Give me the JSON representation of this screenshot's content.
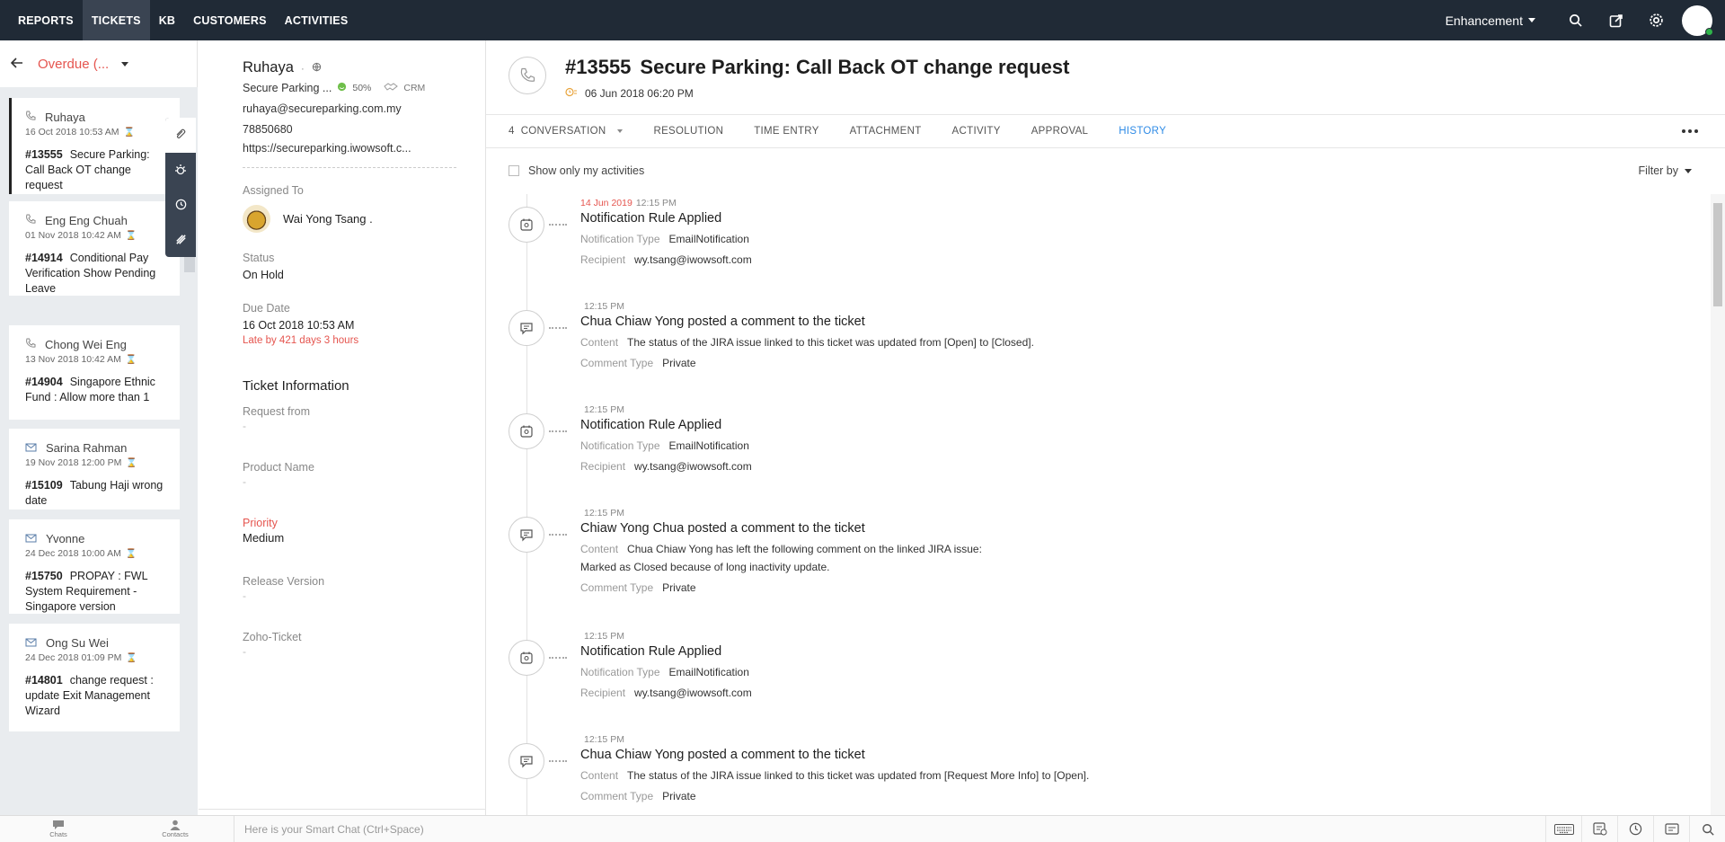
{
  "nav": {
    "items": [
      "REPORTS",
      "TICKETS",
      "KB",
      "CUSTOMERS",
      "ACTIVITIES"
    ],
    "active": "TICKETS",
    "department": "Enhancement"
  },
  "list": {
    "view_label": "Overdue (...",
    "cards": [
      {
        "contact": "Ruhaya",
        "time": "16 Oct 2018 10:53 AM",
        "number": "#13555",
        "subject": "Secure Parking: Call Back OT change request",
        "channel": "phone"
      },
      {
        "contact": "Eng Eng Chuah",
        "time": "01 Nov 2018 10:42 AM",
        "number": "#14914",
        "subject": "Conditional Pay Verification Show Pending Leave",
        "channel": "phone"
      },
      {
        "contact": "Chong Wei Eng",
        "time": "13 Nov 2018 10:42 AM",
        "number": "#14904",
        "subject": "Singapore Ethnic Fund : Allow more than 1",
        "channel": "phone"
      },
      {
        "contact": "Sarina Rahman",
        "time": "19 Nov 2018 12:00 PM",
        "number": "#15109",
        "subject": "Tabung Haji wrong date",
        "channel": "email"
      },
      {
        "contact": "Yvonne",
        "time": "24 Dec 2018 10:00 AM",
        "number": "#15750",
        "subject": "PROPAY : FWL System Requirement - Singapore version",
        "channel": "email"
      },
      {
        "contact": "Ong Su Wei",
        "time": "24 Dec 2018 01:09 PM",
        "number": "#14801",
        "subject": "change request : update Exit Management Wizard",
        "channel": "email"
      }
    ]
  },
  "contact": {
    "name": "Ruhaya",
    "account": "Secure Parking ...",
    "happiness": "50%",
    "crm": "CRM",
    "email": "ruhaya@secureparking.com.my",
    "phone": "78850680",
    "website": "https://secureparking.iwowsoft.c..."
  },
  "props": {
    "assigned_label": "Assigned To",
    "assigned_value": "Wai Yong Tsang .",
    "status_label": "Status",
    "status_value": "On Hold",
    "due_label": "Due Date",
    "due_value": "16 Oct 2018 10:53 AM",
    "late": "Late by 421 days 3 hours",
    "section": "Ticket Information",
    "request_label": "Request from",
    "request_value": "-",
    "product_label": "Product Name",
    "product_value": "-",
    "priority_label": "Priority",
    "priority_value": "Medium",
    "release_label": "Release Version",
    "release_value": "-",
    "zoho_label": "Zoho-Ticket",
    "zoho_value": "-"
  },
  "ticket": {
    "number": "#13555",
    "subject": "Secure Parking: Call Back OT change request",
    "created": "06 Jun 2018 06:20 PM"
  },
  "tabs": {
    "conversation_count": "4",
    "items": [
      "CONVERSATION",
      "RESOLUTION",
      "TIME ENTRY",
      "ATTACHMENT",
      "ACTIVITY",
      "APPROVAL",
      "HISTORY"
    ],
    "active": "HISTORY"
  },
  "history": {
    "show_mine": "Show only my activities",
    "filter": "Filter by",
    "entries": [
      {
        "date": "14 Jun 2019",
        "time": "12:15 PM",
        "title": "Notification Rule Applied",
        "icon": "rule-icon",
        "rows": [
          {
            "k": "Notification Type",
            "v": "EmailNotification"
          },
          {
            "k": "Recipient",
            "v": "wy.tsang@iwowsoft.com"
          }
        ]
      },
      {
        "date": "",
        "time": "12:15 PM",
        "title": "Chua Chiaw Yong posted a comment to the ticket",
        "icon": "comment-icon",
        "rows": [
          {
            "k": "Content",
            "v": "The status of the JIRA issue linked to this ticket was updated from [Open] to [Closed]."
          },
          {
            "k": "Comment Type",
            "v": "Private"
          }
        ]
      },
      {
        "date": "",
        "time": "12:15 PM",
        "title": "Notification Rule Applied",
        "icon": "rule-icon",
        "rows": [
          {
            "k": "Notification Type",
            "v": "EmailNotification"
          },
          {
            "k": "Recipient",
            "v": "wy.tsang@iwowsoft.com"
          }
        ]
      },
      {
        "date": "",
        "time": "12:15 PM",
        "title": "Chiaw Yong Chua posted a comment to the ticket",
        "icon": "comment-icon",
        "rows": [
          {
            "k": "Content",
            "v": "Chua Chiaw Yong has left the following comment on the linked JIRA issue:"
          },
          {
            "k": "",
            "v": "Marked as Closed because of long inactivity update."
          },
          {
            "k": "Comment Type",
            "v": "Private"
          }
        ]
      },
      {
        "date": "",
        "time": "12:15 PM",
        "title": "Notification Rule Applied",
        "icon": "rule-icon",
        "rows": [
          {
            "k": "Notification Type",
            "v": "EmailNotification"
          },
          {
            "k": "Recipient",
            "v": "wy.tsang@iwowsoft.com"
          }
        ]
      },
      {
        "date": "",
        "time": "12:15 PM",
        "title": "Chua Chiaw Yong posted a comment to the ticket",
        "icon": "comment-icon",
        "rows": [
          {
            "k": "Content",
            "v": "The status of the JIRA issue linked to this ticket was updated from [Request More Info] to [Open]."
          },
          {
            "k": "Comment Type",
            "v": "Private"
          }
        ]
      }
    ]
  },
  "bottom": {
    "chats": "Chats",
    "contacts": "Contacts",
    "smart_chat": "Here is your Smart Chat (Ctrl+Space)"
  }
}
